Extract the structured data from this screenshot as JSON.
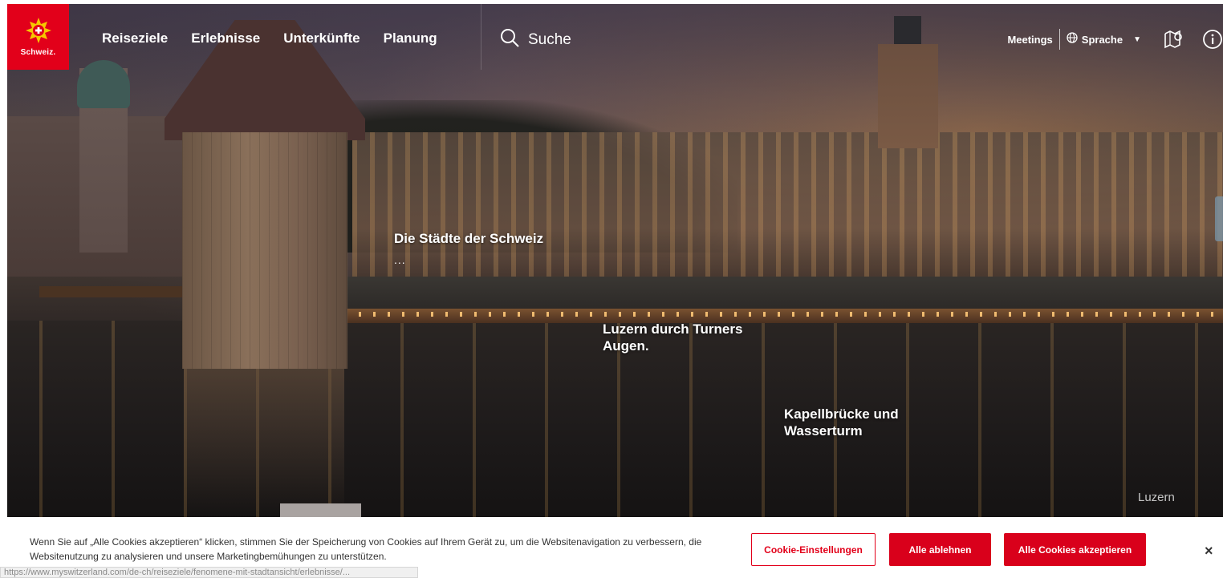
{
  "brand": {
    "logo_text": "Schweiz.",
    "logo_icon": "swiss-star-flower-icon",
    "accent_color": "#e2001a"
  },
  "nav": {
    "items": [
      {
        "label": "Reiseziele"
      },
      {
        "label": "Erlebnisse"
      },
      {
        "label": "Unterkünfte"
      },
      {
        "label": "Planung"
      }
    ],
    "search_label": "Suche",
    "search_icon": "search-icon"
  },
  "top_right": {
    "meetings_label": "Meetings",
    "language_label": "Sprache",
    "language_icon": "globe-icon",
    "map_icon": "map-pin-icon",
    "info_icon": "info-icon"
  },
  "hero": {
    "hotspots": [
      {
        "label": "Die Städte der Schweiz",
        "extra": "..."
      },
      {
        "label": "Luzern durch Turners Augen."
      },
      {
        "label": "Kapellbrücke und Wasserturm"
      }
    ],
    "location_label": "Luzern"
  },
  "cookie": {
    "text": "Wenn Sie auf „Alle Cookies akzeptieren“ klicken, stimmen Sie der Speicherung von Cookies auf Ihrem Gerät zu, um die Websitenavigation zu verbessern, die Websitenutzung zu analysieren und unsere Marketingbemühungen zu unterstützen.",
    "settings_label": "Cookie-Einstellungen",
    "reject_label": "Alle ablehnen",
    "accept_label": "Alle Cookies akzeptieren",
    "close_label": "×"
  },
  "status_bar": {
    "url": "https://www.myswitzerland.com/de-ch/reiseziele/fenomene-mit-stadtansicht/erlebnisse/..."
  }
}
